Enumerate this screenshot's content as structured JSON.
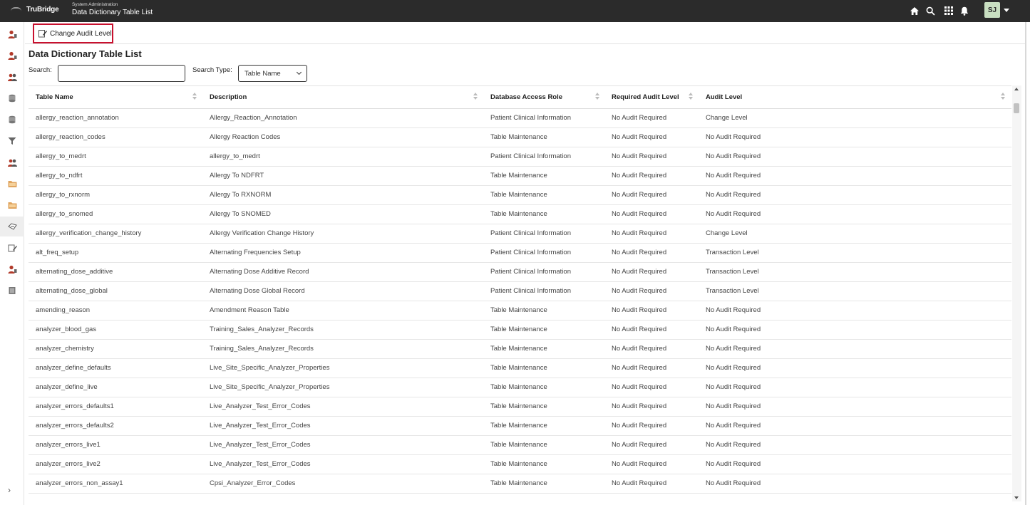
{
  "header": {
    "brand": "TruBridge",
    "breadcrumb_parent": "System Administration",
    "breadcrumb_title": "Data Dictionary Table List",
    "icons": [
      "home-icon",
      "search-icon",
      "apps-grid-icon",
      "bell-icon"
    ],
    "user_initials": "SJ"
  },
  "sidebar": {
    "icons": [
      "user-icon",
      "user-icon",
      "users-icon",
      "database-icon",
      "database-icon",
      "filter-icon",
      "users-icon",
      "folder-icon",
      "folder-icon",
      "tag-icon",
      "edit-icon",
      "user-icon",
      "book-icon"
    ],
    "expand_label": "›"
  },
  "toolbar": {
    "change_audit_label": "Change Audit Level"
  },
  "page": {
    "title": "Data Dictionary Table List",
    "search_label": "Search:",
    "search_value": "",
    "search_type_label": "Search Type:",
    "search_type_value": "Table Name"
  },
  "table": {
    "columns": [
      "Table Name",
      "Description",
      "Database Access Role",
      "Required Audit Level",
      "Audit Level"
    ],
    "rows": [
      [
        "allergy_reaction_annotation",
        "Allergy_Reaction_Annotation",
        "Patient Clinical Information",
        "No Audit Required",
        "Change Level"
      ],
      [
        "allergy_reaction_codes",
        "Allergy Reaction Codes",
        "Table Maintenance",
        "No Audit Required",
        "No Audit Required"
      ],
      [
        "allergy_to_medrt",
        "allergy_to_medrt",
        "Patient Clinical Information",
        "No Audit Required",
        "No Audit Required"
      ],
      [
        "allergy_to_ndfrt",
        "Allergy To NDFRT",
        "Table Maintenance",
        "No Audit Required",
        "No Audit Required"
      ],
      [
        "allergy_to_rxnorm",
        "Allergy To RXNORM",
        "Table Maintenance",
        "No Audit Required",
        "No Audit Required"
      ],
      [
        "allergy_to_snomed",
        "Allergy To SNOMED",
        "Table Maintenance",
        "No Audit Required",
        "No Audit Required"
      ],
      [
        "allergy_verification_change_history",
        "Allergy Verification Change History",
        "Patient Clinical Information",
        "No Audit Required",
        "Change Level"
      ],
      [
        "alt_freq_setup",
        "Alternating Frequencies Setup",
        "Patient Clinical Information",
        "No Audit Required",
        "Transaction Level"
      ],
      [
        "alternating_dose_additive",
        "Alternating Dose Additive Record",
        "Patient Clinical Information",
        "No Audit Required",
        "Transaction Level"
      ],
      [
        "alternating_dose_global",
        "Alternating Dose Global Record",
        "Patient Clinical Information",
        "No Audit Required",
        "Transaction Level"
      ],
      [
        "amending_reason",
        "Amendment Reason Table",
        "Table Maintenance",
        "No Audit Required",
        "No Audit Required"
      ],
      [
        "analyzer_blood_gas",
        "Training_Sales_Analyzer_Records",
        "Table Maintenance",
        "No Audit Required",
        "No Audit Required"
      ],
      [
        "analyzer_chemistry",
        "Training_Sales_Analyzer_Records",
        "Table Maintenance",
        "No Audit Required",
        "No Audit Required"
      ],
      [
        "analyzer_define_defaults",
        "Live_Site_Specific_Analyzer_Properties",
        "Table Maintenance",
        "No Audit Required",
        "No Audit Required"
      ],
      [
        "analyzer_define_live",
        "Live_Site_Specific_Analyzer_Properties",
        "Table Maintenance",
        "No Audit Required",
        "No Audit Required"
      ],
      [
        "analyzer_errors_defaults1",
        "Live_Analyzer_Test_Error_Codes",
        "Table Maintenance",
        "No Audit Required",
        "No Audit Required"
      ],
      [
        "analyzer_errors_defaults2",
        "Live_Analyzer_Test_Error_Codes",
        "Table Maintenance",
        "No Audit Required",
        "No Audit Required"
      ],
      [
        "analyzer_errors_live1",
        "Live_Analyzer_Test_Error_Codes",
        "Table Maintenance",
        "No Audit Required",
        "No Audit Required"
      ],
      [
        "analyzer_errors_live2",
        "Live_Analyzer_Test_Error_Codes",
        "Table Maintenance",
        "No Audit Required",
        "No Audit Required"
      ],
      [
        "analyzer_errors_non_assay1",
        "Cpsi_Analyzer_Error_Codes",
        "Table Maintenance",
        "No Audit Required",
        "No Audit Required"
      ]
    ]
  },
  "colors": {
    "topbar": "#2b2b2b",
    "highlight_border": "#c8102e",
    "avatar_bg": "#c9dfc1"
  }
}
